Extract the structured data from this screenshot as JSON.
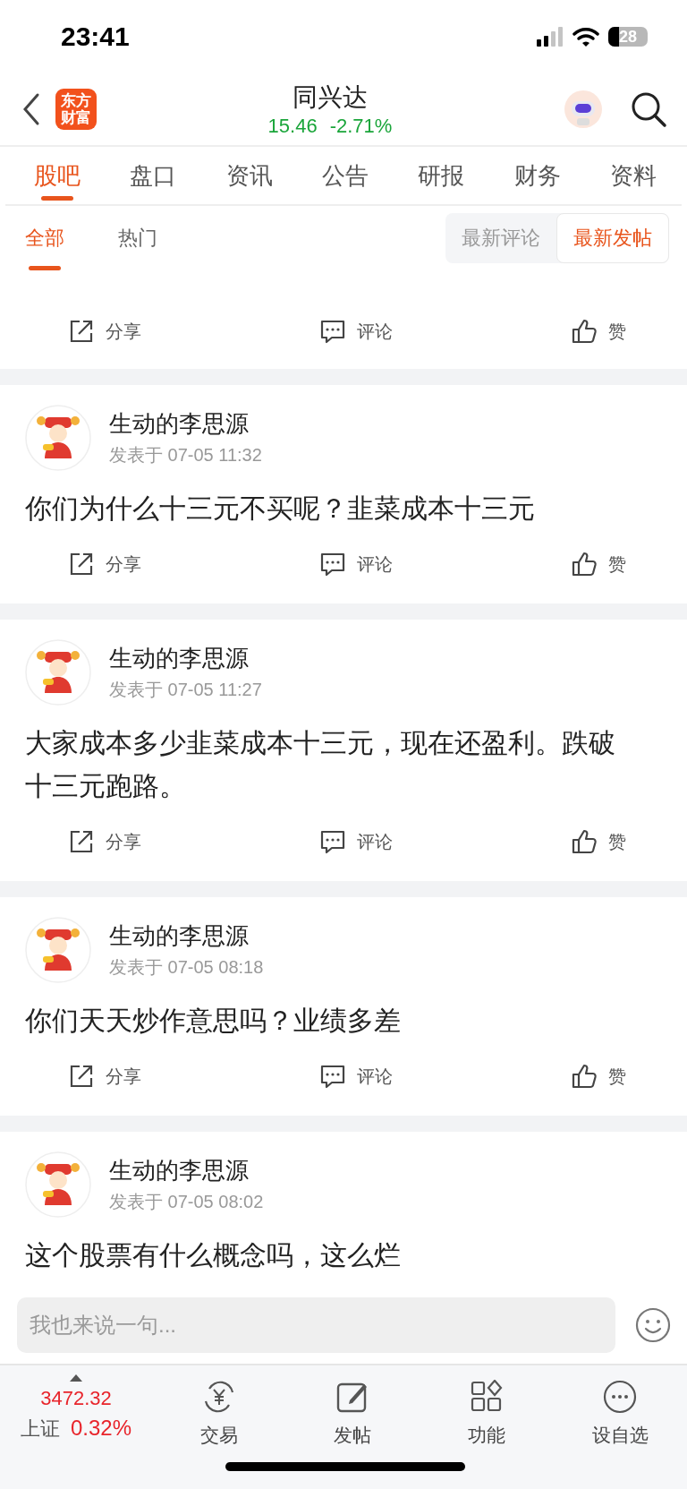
{
  "status_bar": {
    "time": "23:41",
    "battery": "28"
  },
  "header": {
    "logo": "东方财富",
    "title": "同兴达",
    "price": "15.46",
    "change": "-2.71%"
  },
  "tabs": [
    {
      "label": "股吧",
      "selected": true
    },
    {
      "label": "盘口",
      "selected": false
    },
    {
      "label": "资讯",
      "selected": false
    },
    {
      "label": "公告",
      "selected": false
    },
    {
      "label": "研报",
      "selected": false
    },
    {
      "label": "财务",
      "selected": false
    },
    {
      "label": "资料",
      "selected": false
    }
  ],
  "subtabs": [
    {
      "label": "全部",
      "selected": true
    },
    {
      "label": "热门",
      "selected": false
    }
  ],
  "sort_toggle": [
    {
      "label": "最新评论",
      "selected": false
    },
    {
      "label": "最新发帖",
      "selected": true
    }
  ],
  "posts": [
    {
      "kind": "partial",
      "actions": [
        "分享",
        "评论",
        "赞"
      ]
    },
    {
      "kind": "full",
      "author": "生动的李思源",
      "time": "发表于 07-05 11:32",
      "content": "你们为什么十三元不买呢？韭菜成本十三元",
      "actions": [
        "分享",
        "评论",
        "赞"
      ]
    },
    {
      "kind": "full",
      "author": "生动的李思源",
      "time": "发表于 07-05 11:27",
      "content": "大家成本多少韭菜成本十三元，现在还盈利。跌破十三元跑路。",
      "actions": [
        "分享",
        "评论",
        "赞"
      ]
    },
    {
      "kind": "full",
      "author": "生动的李思源",
      "time": "发表于 07-05 08:18",
      "content": "你们天天炒作意思吗？业绩多差",
      "actions": [
        "分享",
        "评论",
        "赞"
      ]
    },
    {
      "kind": "full",
      "author": "生动的李思源",
      "time": "发表于 07-05 08:02",
      "content": "这个股票有什么概念吗，这么烂"
    }
  ],
  "comment_input": {
    "placeholder": "我也来说一句..."
  },
  "market": {
    "value": "3472.32",
    "name": "上证",
    "change": "0.32%"
  },
  "nav": [
    {
      "kind": "trade",
      "label": "交易"
    },
    {
      "kind": "post",
      "label": "发帖"
    },
    {
      "kind": "functions",
      "label": "功能"
    },
    {
      "kind": "more",
      "label": "设自选"
    }
  ]
}
